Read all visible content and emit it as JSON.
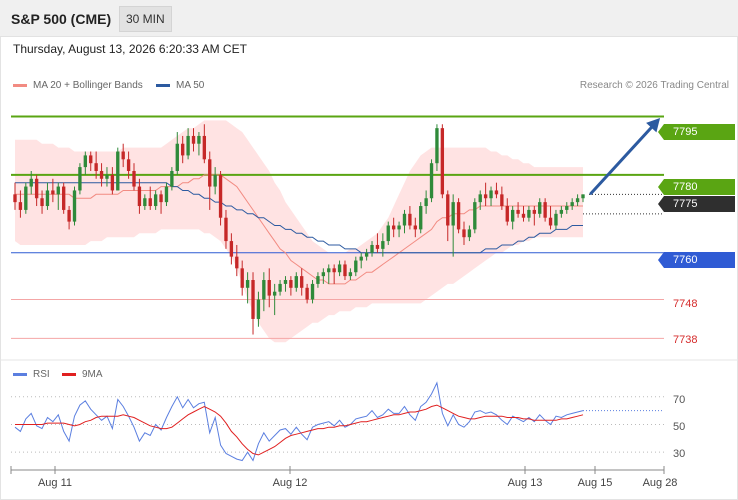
{
  "header": {
    "title": "S&P 500 (CME)",
    "timeframe": "30 MIN"
  },
  "datetime": "Thursday, August 13, 2026 6:20:33 AM CET",
  "legend": {
    "ma20": {
      "label": "MA 20 + Bollinger Bands",
      "color": "#f28b82"
    },
    "ma50": {
      "label": "MA 50",
      "color": "#2c5aa0"
    }
  },
  "credit": "Research © 2026 Trading Central",
  "levels": {
    "l7795": {
      "label": "7795",
      "value": 7795,
      "color": "#5aa513"
    },
    "l7780": {
      "label": "7780",
      "value": 7780,
      "color": "#5aa513"
    },
    "l7775": {
      "label": "7775",
      "value": 7775,
      "color": "#2f2f2f"
    },
    "l7760": {
      "label": "7760",
      "value": 7760,
      "color": "#2f5bd4"
    },
    "l7748": {
      "label": "7748",
      "value": 7748,
      "color": "#f4a6a6"
    },
    "l7738": {
      "label": "7738",
      "value": 7738,
      "color": "#f4a6a6"
    }
  },
  "rsi": {
    "legend_rsi": "RSI",
    "legend_ma": "9MA",
    "rsi_color": "#5b7fe0",
    "ma_color": "#e02020",
    "levels": [
      "70",
      "50",
      "30"
    ]
  },
  "x_axis": {
    "labels": [
      "Aug 11",
      "Aug 12",
      "Aug 13",
      "Aug 15",
      "Aug 28"
    ]
  },
  "chart_data": {
    "type": "candlestick",
    "y_range": [
      7734,
      7800
    ],
    "rsi_range": [
      20,
      85
    ],
    "candles": [
      [
        7775,
        7778,
        7771,
        7773
      ],
      [
        7773,
        7776,
        7769,
        7771
      ],
      [
        7771,
        7778,
        7770,
        7777
      ],
      [
        7777,
        7781,
        7775,
        7779
      ],
      [
        7779,
        7780,
        7772,
        7774
      ],
      [
        7774,
        7776,
        7770,
        7772
      ],
      [
        7772,
        7778,
        7771,
        7776
      ],
      [
        7776,
        7779,
        7773,
        7775
      ],
      [
        7775,
        7778,
        7771,
        7777
      ],
      [
        7777,
        7778,
        7770,
        7771
      ],
      [
        7771,
        7772,
        7766,
        7768
      ],
      [
        7768,
        7777,
        7767,
        7776
      ],
      [
        7776,
        7783,
        7775,
        7782
      ],
      [
        7782,
        7786,
        7780,
        7785
      ],
      [
        7785,
        7786,
        7781,
        7783
      ],
      [
        7783,
        7786,
        7779,
        7781
      ],
      [
        7781,
        7783,
        7777,
        7779
      ],
      [
        7779,
        7782,
        7777,
        7780
      ],
      [
        7780,
        7782,
        7775,
        7776
      ],
      [
        7776,
        7787,
        7776,
        7786
      ],
      [
        7786,
        7788,
        7782,
        7784
      ],
      [
        7784,
        7786,
        7779,
        7781
      ],
      [
        7781,
        7783,
        7776,
        7777
      ],
      [
        7777,
        7779,
        7770,
        7772
      ],
      [
        7772,
        7775,
        7771,
        7774
      ],
      [
        7774,
        7777,
        7771,
        7772
      ],
      [
        7772,
        7776,
        7771,
        7775
      ],
      [
        7775,
        7776,
        7770,
        7773
      ],
      [
        7773,
        7778,
        7772,
        7777
      ],
      [
        7777,
        7782,
        7776,
        7781
      ],
      [
        7781,
        7791,
        7780,
        7788
      ],
      [
        7788,
        7790,
        7783,
        7785
      ],
      [
        7785,
        7792,
        7784,
        7790
      ],
      [
        7790,
        7792,
        7786,
        7788
      ],
      [
        7788,
        7791,
        7785,
        7790
      ],
      [
        7790,
        7793,
        7783,
        7784
      ],
      [
        7784,
        7786,
        7771,
        7777
      ],
      [
        7777,
        7782,
        7775,
        7780
      ],
      [
        7780,
        7781,
        7767,
        7769
      ],
      [
        7769,
        7771,
        7761,
        7763
      ],
      [
        7763,
        7765,
        7757,
        7759
      ],
      [
        7759,
        7762,
        7754,
        7756
      ],
      [
        7756,
        7758,
        7749,
        7751
      ],
      [
        7751,
        7755,
        7747,
        7753
      ],
      [
        7753,
        7755,
        7739,
        7743
      ],
      [
        7743,
        7750,
        7741,
        7748
      ],
      [
        7748,
        7755,
        7745,
        7753
      ],
      [
        7753,
        7756,
        7746,
        7749
      ],
      [
        7749,
        7752,
        7744,
        7750
      ],
      [
        7750,
        7753,
        7749,
        7752
      ],
      [
        7752,
        7754,
        7750,
        7753
      ],
      [
        7753,
        7754,
        7749,
        7751
      ],
      [
        7751,
        7755,
        7750,
        7754
      ],
      [
        7754,
        7756,
        7749,
        7751
      ],
      [
        7751,
        7752,
        7747,
        7748
      ],
      [
        7748,
        7753,
        7747,
        7752
      ],
      [
        7752,
        7755,
        7751,
        7754
      ],
      [
        7754,
        7756,
        7752,
        7755
      ],
      [
        7755,
        7757,
        7752,
        7756
      ],
      [
        7756,
        7757,
        7752,
        7755
      ],
      [
        7755,
        7758,
        7754,
        7757
      ],
      [
        7757,
        7758,
        7753,
        7754
      ],
      [
        7754,
        7756,
        7753,
        7755
      ],
      [
        7755,
        7759,
        7754,
        7758
      ],
      [
        7758,
        7760,
        7756,
        7759
      ],
      [
        7759,
        7761,
        7758,
        7760
      ],
      [
        7760,
        7763,
        7759,
        7762
      ],
      [
        7762,
        7765,
        7760,
        7761
      ],
      [
        7761,
        7765,
        7759,
        7763
      ],
      [
        7763,
        7768,
        7762,
        7767
      ],
      [
        7767,
        7769,
        7764,
        7766
      ],
      [
        7766,
        7768,
        7764,
        7767
      ],
      [
        7767,
        7771,
        7765,
        7770
      ],
      [
        7770,
        7772,
        7766,
        7767
      ],
      [
        7767,
        7769,
        7764,
        7766
      ],
      [
        7766,
        7773,
        7765,
        7772
      ],
      [
        7772,
        7776,
        7770,
        7774
      ],
      [
        7774,
        7784,
        7773,
        7783
      ],
      [
        7783,
        7793,
        7781,
        7792
      ],
      [
        7792,
        7793,
        7774,
        7775
      ],
      [
        7775,
        7776,
        7763,
        7767
      ],
      [
        7767,
        7775,
        7759,
        7773
      ],
      [
        7773,
        7774,
        7765,
        7766
      ],
      [
        7766,
        7768,
        7762,
        7764
      ],
      [
        7764,
        7767,
        7763,
        7766
      ],
      [
        7766,
        7774,
        7765,
        7773
      ],
      [
        7773,
        7776,
        7771,
        7775
      ],
      [
        7775,
        7778,
        7772,
        7774
      ],
      [
        7774,
        7777,
        7772,
        7776
      ],
      [
        7776,
        7778,
        7774,
        7775
      ],
      [
        7775,
        7777,
        7771,
        7772
      ],
      [
        7772,
        7774,
        7767,
        7768
      ],
      [
        7768,
        7772,
        7766,
        7771
      ],
      [
        7771,
        7773,
        7769,
        7770
      ],
      [
        7770,
        7772,
        7768,
        7769
      ],
      [
        7769,
        7772,
        7768,
        7771
      ],
      [
        7771,
        7772,
        7767,
        7770
      ],
      [
        7770,
        7774,
        7769,
        7773
      ],
      [
        7773,
        7774,
        7768,
        7769
      ],
      [
        7769,
        7772,
        7766,
        7767
      ],
      [
        7767,
        7771,
        7766,
        7770
      ],
      [
        7770,
        7772,
        7769,
        7771
      ],
      [
        7771,
        7773,
        7770,
        7772
      ],
      [
        7772,
        7774,
        7771,
        7773
      ],
      [
        7773,
        7775,
        7772,
        7774
      ],
      [
        7774,
        7775,
        7773,
        7775
      ]
    ],
    "ma20": [
      7775,
      7775,
      7775,
      7775,
      7775,
      7775,
      7775,
      7775,
      7775,
      7775,
      7775,
      7774,
      7774,
      7774,
      7774,
      7775,
      7775,
      7775,
      7775,
      7775,
      7776,
      7776,
      7776,
      7776,
      7776,
      7776,
      7776,
      7777,
      7777,
      7777,
      7777,
      7778,
      7778,
      7779,
      7779,
      7780,
      7780,
      7780,
      7780,
      7779,
      7778,
      7777,
      7775,
      7773,
      7771,
      7769,
      7767,
      7765,
      7763,
      7761,
      7760,
      7758,
      7757,
      7756,
      7755,
      7754,
      7753,
      7753,
      7752,
      7752,
      7752,
      7752,
      7753,
      7753,
      7754,
      7755,
      7755,
      7756,
      7757,
      7758,
      7759,
      7760,
      7761,
      7762,
      7763,
      7764,
      7765,
      7766,
      7768,
      7769,
      7769,
      7770,
      7770,
      7770,
      7771,
      7771,
      7772,
      7772,
      7772,
      7772,
      7772,
      7772,
      7772,
      7772,
      7772,
      7772,
      7772,
      7772,
      7772,
      7772,
      7772,
      7772,
      7772,
      7772,
      7772,
      7772
    ],
    "bb_upper": [
      7789,
      7789,
      7789,
      7789,
      7789,
      7788,
      7788,
      7788,
      7787,
      7787,
      7787,
      7786,
      7786,
      7786,
      7786,
      7786,
      7786,
      7786,
      7786,
      7786,
      7787,
      7787,
      7787,
      7787,
      7787,
      7787,
      7787,
      7787,
      7788,
      7789,
      7790,
      7791,
      7792,
      7792,
      7793,
      7794,
      7794,
      7794,
      7794,
      7794,
      7793,
      7792,
      7791,
      7789,
      7787,
      7785,
      7783,
      7781,
      7778,
      7776,
      7773,
      7771,
      7769,
      7767,
      7765,
      7763,
      7762,
      7761,
      7760,
      7760,
      7760,
      7760,
      7761,
      7761,
      7762,
      7763,
      7764,
      7765,
      7767,
      7769,
      7772,
      7775,
      7778,
      7781,
      7783,
      7785,
      7786,
      7787,
      7787,
      7787,
      7787,
      7787,
      7787,
      7787,
      7787,
      7787,
      7787,
      7787,
      7786,
      7786,
      7785,
      7785,
      7784,
      7784,
      7783,
      7783,
      7782,
      7782,
      7782,
      7782,
      7782,
      7782,
      7782,
      7782,
      7782,
      7782
    ],
    "bb_lower": [
      7763,
      7762,
      7762,
      7762,
      7762,
      7762,
      7762,
      7762,
      7762,
      7762,
      7762,
      7762,
      7762,
      7762,
      7763,
      7763,
      7763,
      7764,
      7764,
      7764,
      7764,
      7764,
      7764,
      7765,
      7765,
      7765,
      7765,
      7766,
      7766,
      7766,
      7766,
      7766,
      7766,
      7766,
      7766,
      7765,
      7765,
      7764,
      7763,
      7761,
      7759,
      7756,
      7752,
      7748,
      7745,
      7742,
      7740,
      7738,
      7737,
      7737,
      7737,
      7738,
      7739,
      7740,
      7741,
      7742,
      7742,
      7743,
      7744,
      7744,
      7745,
      7745,
      7745,
      7746,
      7746,
      7746,
      7747,
      7747,
      7747,
      7747,
      7747,
      7747,
      7747,
      7747,
      7747,
      7747,
      7748,
      7749,
      7750,
      7751,
      7752,
      7752,
      7753,
      7754,
      7755,
      7756,
      7757,
      7758,
      7759,
      7760,
      7760,
      7761,
      7762,
      7762,
      7763,
      7763,
      7764,
      7764,
      7764,
      7764,
      7764,
      7764,
      7764,
      7764,
      7764,
      7764
    ],
    "ma50": [
      7778,
      7778,
      7778,
      7778,
      7778,
      7778,
      7778,
      7778,
      7778,
      7778,
      7778,
      7778,
      7778,
      7778,
      7778,
      7778,
      7778,
      7778,
      7778,
      7778,
      7778,
      7778,
      7778,
      7778,
      7778,
      7778,
      7778,
      7778,
      7778,
      7777,
      7777,
      7776,
      7776,
      7775,
      7775,
      7774,
      7774,
      7773,
      7773,
      7772,
      7772,
      7771,
      7771,
      7770,
      7770,
      7769,
      7769,
      7768,
      7767,
      7767,
      7766,
      7766,
      7765,
      7765,
      7764,
      7764,
      7763,
      7763,
      7762,
      7762,
      7762,
      7761,
      7761,
      7761,
      7760,
      7760,
      7760,
      7760,
      7760,
      7760,
      7760,
      7760,
      7760,
      7760,
      7760,
      7760,
      7760,
      7760,
      7760,
      7760,
      7760,
      7760,
      7760,
      7760,
      7760,
      7760,
      7760,
      7761,
      7761,
      7761,
      7762,
      7762,
      7762,
      7763,
      7763,
      7764,
      7764,
      7765,
      7765,
      7765,
      7766,
      7766,
      7766,
      7767,
      7767,
      7767
    ],
    "rsi": [
      48,
      45,
      54,
      58,
      49,
      47,
      55,
      52,
      57,
      45,
      38,
      56,
      64,
      67,
      61,
      57,
      53,
      56,
      47,
      68,
      63,
      56,
      48,
      38,
      44,
      42,
      50,
      46,
      55,
      63,
      70,
      62,
      68,
      62,
      65,
      66,
      44,
      55,
      35,
      29,
      27,
      25,
      24,
      30,
      24,
      36,
      44,
      38,
      42,
      46,
      47,
      43,
      48,
      43,
      39,
      48,
      50,
      51,
      52,
      49,
      53,
      48,
      50,
      54,
      55,
      56,
      60,
      55,
      57,
      61,
      58,
      58,
      63,
      57,
      53,
      63,
      66,
      72,
      80,
      58,
      49,
      57,
      50,
      48,
      52,
      59,
      60,
      58,
      59,
      57,
      53,
      50,
      56,
      54,
      52,
      55,
      52,
      57,
      53,
      50,
      56,
      55,
      57,
      58,
      59,
      60
    ],
    "rsi_ma": [
      50,
      50,
      50,
      50,
      50,
      50,
      51,
      51,
      51,
      51,
      50,
      49,
      50,
      52,
      53,
      55,
      56,
      56,
      56,
      56,
      57,
      56,
      55,
      53,
      51,
      49,
      48,
      47,
      47,
      48,
      51,
      54,
      57,
      59,
      61,
      63,
      61,
      59,
      56,
      51,
      45,
      41,
      36,
      32,
      29,
      28,
      30,
      32,
      34,
      37,
      40,
      42,
      43,
      44,
      45,
      46,
      47,
      47,
      48,
      48,
      49,
      49,
      50,
      51,
      52,
      52,
      53,
      54,
      55,
      56,
      57,
      57,
      58,
      59,
      59,
      60,
      61,
      63,
      64,
      62,
      60,
      58,
      56,
      55,
      54,
      54,
      55,
      56,
      56,
      56,
      56,
      55,
      55,
      55,
      54,
      54,
      53,
      53,
      53,
      53,
      53,
      54,
      54,
      55,
      56,
      57
    ]
  }
}
